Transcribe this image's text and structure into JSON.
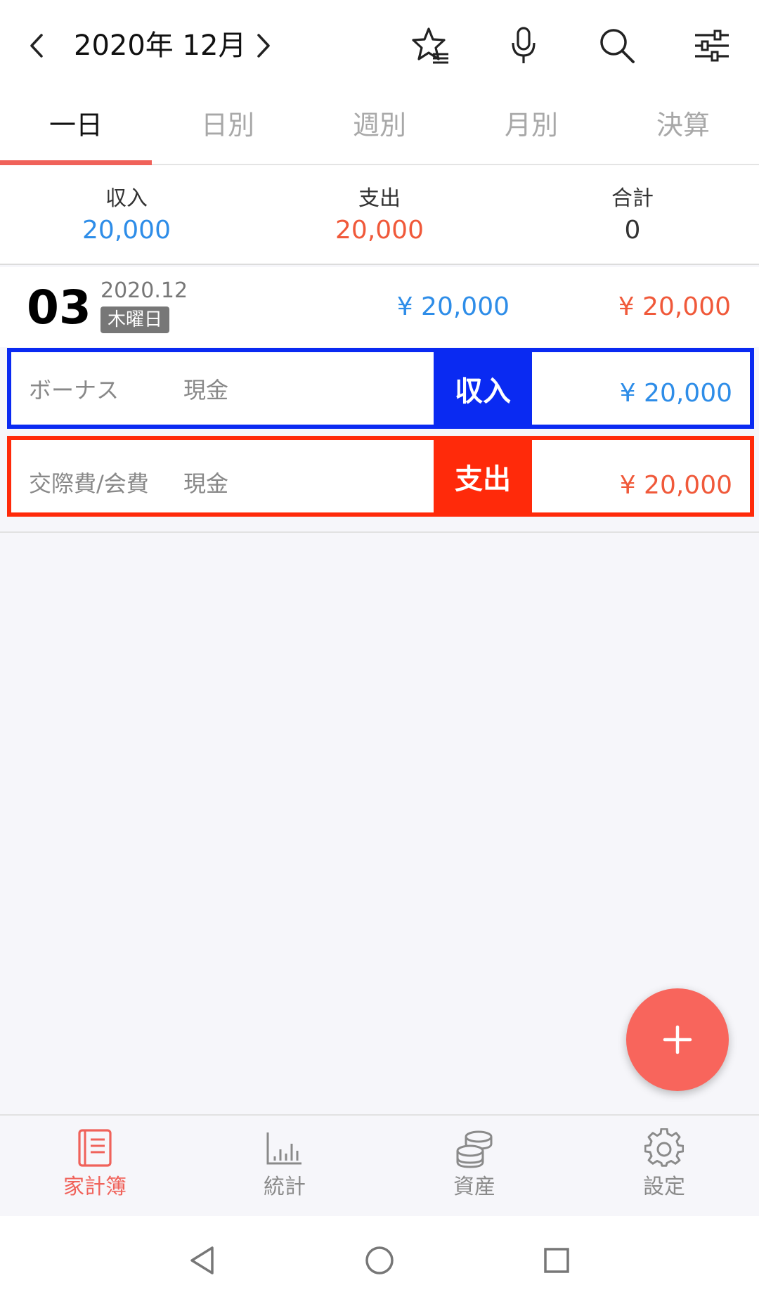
{
  "header": {
    "month_title": "2020年 12月",
    "icons": [
      "chevron-left-icon",
      "chevron-right-icon",
      "star-list-icon",
      "microphone-icon",
      "search-icon",
      "filter-sliders-icon"
    ]
  },
  "tabs": [
    {
      "label": "一日",
      "active": true
    },
    {
      "label": "日別",
      "active": false
    },
    {
      "label": "週別",
      "active": false
    },
    {
      "label": "月別",
      "active": false
    },
    {
      "label": "決算",
      "active": false
    }
  ],
  "summary": {
    "income_label": "収入",
    "income_value": "20,000",
    "expense_label": "支出",
    "expense_value": "20,000",
    "total_label": "合計",
    "total_value": "0"
  },
  "day": {
    "day_number": "03",
    "year_month": "2020.12",
    "weekday": "木曜日",
    "income": "¥ 20,000",
    "expense": "¥ 20,000"
  },
  "transactions": [
    {
      "category": "ボーナス",
      "account": "現金",
      "type_label": "収入",
      "amount": "¥ 20,000"
    },
    {
      "category": "交際費/会費",
      "account": "現金",
      "type_label": "支出",
      "amount": "¥ 20,000"
    }
  ],
  "bottom_nav": [
    {
      "label": "家計簿",
      "icon": "book-icon",
      "active": true
    },
    {
      "label": "統計",
      "icon": "bar-chart-icon",
      "active": false
    },
    {
      "label": "資産",
      "icon": "coins-icon",
      "active": false
    },
    {
      "label": "設定",
      "icon": "gear-icon",
      "active": false
    }
  ],
  "colors": {
    "accent": "#f0625a",
    "income": "#2e8de8",
    "expense": "#f0593a",
    "income_frame": "#0a2af2",
    "expense_frame": "#ff2a0a"
  }
}
